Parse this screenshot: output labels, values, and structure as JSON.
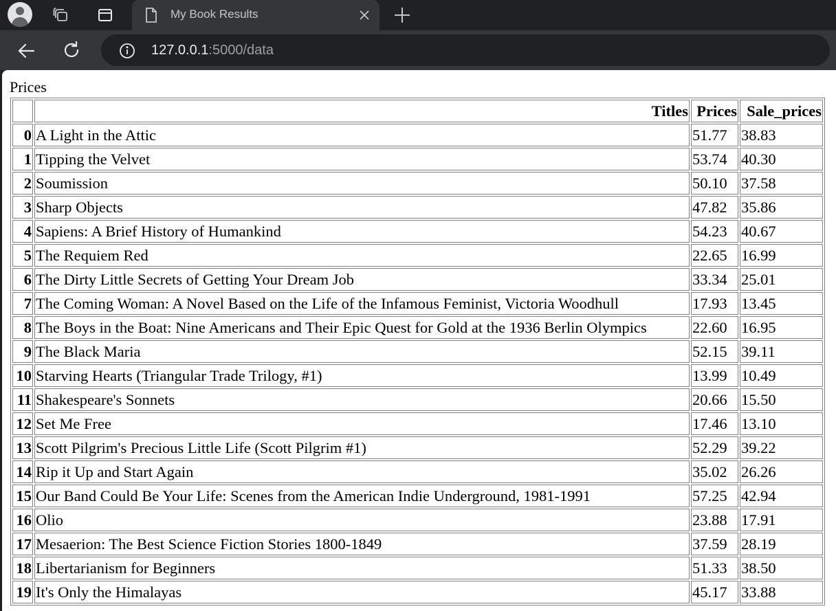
{
  "browser": {
    "tab_title": "My Book Results",
    "url_host": "127.0.0.1",
    "url_rest": ":5000/data"
  },
  "page": {
    "heading": "Prices",
    "table": {
      "columns": [
        "",
        "Titles",
        "Prices",
        "Sale_prices"
      ],
      "rows": [
        {
          "index": "0",
          "title": "A Light in the Attic",
          "price": "51.77",
          "sale": "38.83"
        },
        {
          "index": "1",
          "title": "Tipping the Velvet",
          "price": "53.74",
          "sale": "40.30"
        },
        {
          "index": "2",
          "title": "Soumission",
          "price": "50.10",
          "sale": "37.58"
        },
        {
          "index": "3",
          "title": "Sharp Objects",
          "price": "47.82",
          "sale": "35.86"
        },
        {
          "index": "4",
          "title": "Sapiens: A Brief History of Humankind",
          "price": "54.23",
          "sale": "40.67"
        },
        {
          "index": "5",
          "title": "The Requiem Red",
          "price": "22.65",
          "sale": "16.99"
        },
        {
          "index": "6",
          "title": "The Dirty Little Secrets of Getting Your Dream Job",
          "price": "33.34",
          "sale": "25.01"
        },
        {
          "index": "7",
          "title": "The Coming Woman: A Novel Based on the Life of the Infamous Feminist, Victoria Woodhull",
          "price": "17.93",
          "sale": "13.45"
        },
        {
          "index": "8",
          "title": "The Boys in the Boat: Nine Americans and Their Epic Quest for Gold at the 1936 Berlin Olympics",
          "price": "22.60",
          "sale": "16.95"
        },
        {
          "index": "9",
          "title": "The Black Maria",
          "price": "52.15",
          "sale": "39.11"
        },
        {
          "index": "10",
          "title": "Starving Hearts (Triangular Trade Trilogy, #1)",
          "price": "13.99",
          "sale": "10.49"
        },
        {
          "index": "11",
          "title": "Shakespeare's Sonnets",
          "price": "20.66",
          "sale": "15.50"
        },
        {
          "index": "12",
          "title": "Set Me Free",
          "price": "17.46",
          "sale": "13.10"
        },
        {
          "index": "13",
          "title": "Scott Pilgrim's Precious Little Life (Scott Pilgrim #1)",
          "price": "52.29",
          "sale": "39.22"
        },
        {
          "index": "14",
          "title": "Rip it Up and Start Again",
          "price": "35.02",
          "sale": "26.26"
        },
        {
          "index": "15",
          "title": "Our Band Could Be Your Life: Scenes from the American Indie Underground, 1981-1991",
          "price": "57.25",
          "sale": "42.94"
        },
        {
          "index": "16",
          "title": "Olio",
          "price": "23.88",
          "sale": "17.91"
        },
        {
          "index": "17",
          "title": "Mesaerion: The Best Science Fiction Stories 1800-1849",
          "price": "37.59",
          "sale": "28.19"
        },
        {
          "index": "18",
          "title": "Libertarianism for Beginners",
          "price": "51.33",
          "sale": "38.50"
        },
        {
          "index": "19",
          "title": "It's Only the Himalayas",
          "price": "45.17",
          "sale": "33.88"
        }
      ]
    }
  },
  "icons": {
    "profile": "profile-avatar-icon",
    "workspaces": "workspaces-icon",
    "tab_actions": "tab-actions-icon",
    "tab_page": "document-icon",
    "tab_close": "close-icon",
    "new_tab": "plus-icon",
    "back": "back-arrow-icon",
    "reload": "reload-icon",
    "site_info": "info-icon"
  },
  "colors": {
    "chrome_dark": "#202124",
    "chrome_toolbar": "#35363a",
    "page_bg": "#ffffff",
    "table_border": "#808080"
  }
}
